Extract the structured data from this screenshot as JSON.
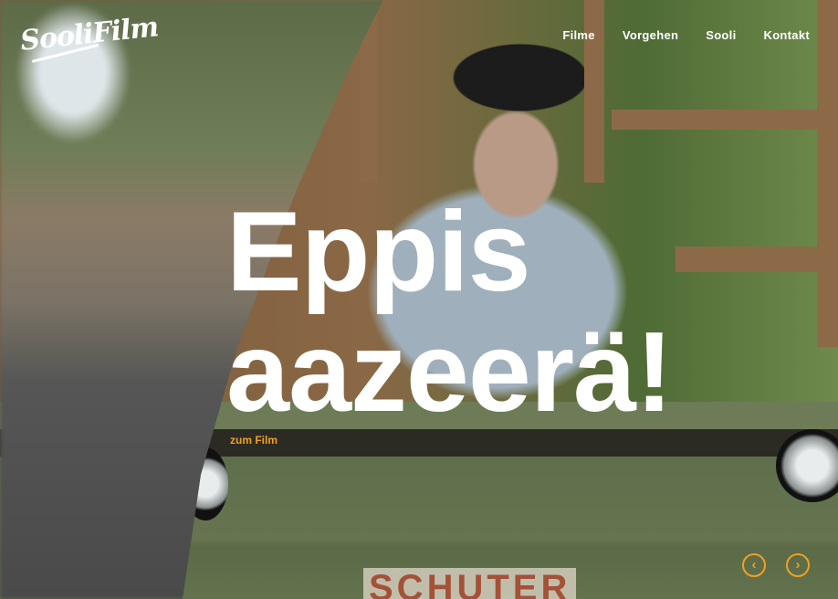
{
  "logo": {
    "text": "SooliFilm"
  },
  "nav": {
    "items": [
      "Filme",
      "Vorgehen",
      "Sooli",
      "Kontakt"
    ]
  },
  "hero": {
    "title_line1": "Eppis",
    "title_line2": "aazeerä!",
    "cta": "zum Film"
  },
  "slider": {
    "prev": "‹",
    "next": "›"
  },
  "background": {
    "plate_text": "SCHUTER"
  },
  "colors": {
    "accent": "#f0a020",
    "text": "#ffffff"
  }
}
